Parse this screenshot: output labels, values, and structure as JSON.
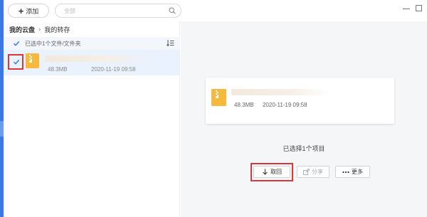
{
  "toolbar": {
    "add_label": "添加",
    "search_placeholder": "全部"
  },
  "breadcrumb": {
    "root": "我的云盘",
    "current": "我的转存"
  },
  "selection_bar": {
    "text": "已选中1个文件/文件夹"
  },
  "file_list": [
    {
      "name": "",
      "size": "48.3MB",
      "date": "2020-11-19 09:58",
      "selected": true
    }
  ],
  "detail": {
    "size": "48.3MB",
    "date": "2020-11-19 09:58",
    "selection_text": "已选择1个项目",
    "actions": {
      "cancel_label": "取回",
      "share_label": "分享",
      "more_label": "更多"
    }
  },
  "colors": {
    "accent": "#3a78e7",
    "highlight": "#d9373c",
    "zip_icon": "#f6b93b",
    "selected_row": "#eaf2fe"
  },
  "icons": [
    "plus-icon",
    "search-icon",
    "minimize-icon",
    "maximize-icon",
    "chevron-right-icon",
    "checkbox-icon",
    "sort-icon",
    "zip-file-icon",
    "download-arrow-icon",
    "share-icon",
    "more-dots-icon"
  ]
}
